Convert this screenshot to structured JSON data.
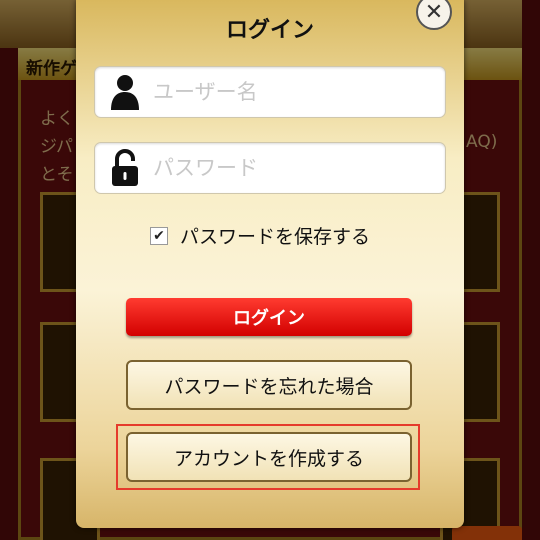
{
  "background": {
    "banner_label": "新作ゲ",
    "text_lines": [
      "よく",
      "ジパ",
      "とそ"
    ],
    "text_right": "AQ)"
  },
  "dialog": {
    "title": "ログイン",
    "close_symbol": "✕",
    "username_placeholder": "ユーザー名",
    "password_placeholder": "パスワード",
    "remember_checked_symbol": "✔",
    "remember_label": "パスワードを保存する",
    "login_button": "ログイン",
    "forgot_button": "パスワードを忘れた場合",
    "create_account_button": "アカウントを作成する"
  },
  "icons": {
    "user": "user-icon",
    "lock": "lock-open-icon",
    "close": "close-icon"
  },
  "colors": {
    "login_red": "#e00000",
    "highlight": "#e53b2c",
    "gold": "#d9b85e"
  }
}
